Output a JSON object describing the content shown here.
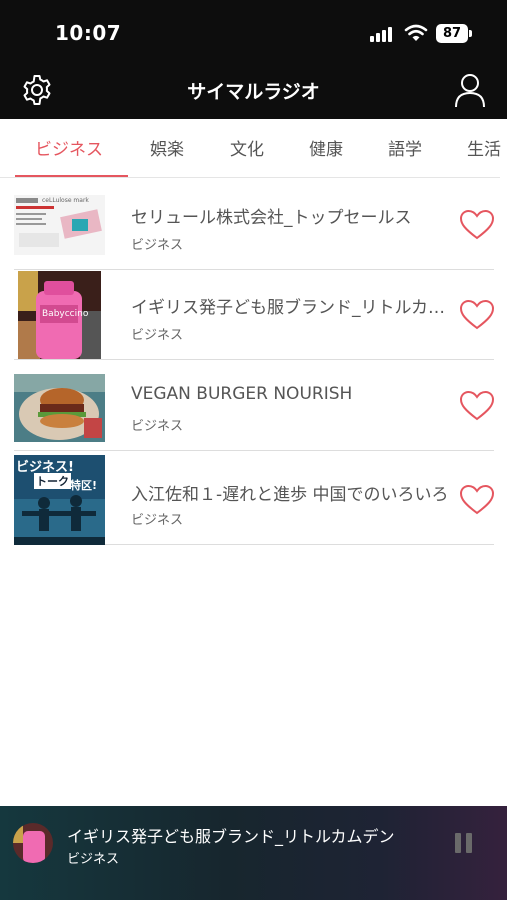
{
  "status_bar": {
    "time": "10:07",
    "battery": "87"
  },
  "header": {
    "title": "サイマルラジオ",
    "settings_icon": "gear-icon",
    "account_icon": "user-icon"
  },
  "tabs": [
    {
      "label": "ビジネス",
      "active": true
    },
    {
      "label": "娯楽",
      "active": false
    },
    {
      "label": "文化",
      "active": false
    },
    {
      "label": "健康",
      "active": false
    },
    {
      "label": "語学",
      "active": false
    },
    {
      "label": "生活",
      "active": false
    }
  ],
  "items": [
    {
      "title": "セリュール株式会社_トップセールス",
      "category": "ビジネス",
      "thumb_text": "ceLLulose mark",
      "favorite": false
    },
    {
      "title": "イギリス発子ども服ブランド_リトルカムデン",
      "category": "ビジネス",
      "thumb_text": "Babyccino",
      "favorite": false
    },
    {
      "title": "VEGAN BURGER NOURISH",
      "category": "ビジネス",
      "favorite": false
    },
    {
      "title": "入江佐和１-遅れと進歩 中国でのいろいろ",
      "category": "ビジネス",
      "thumb_text_1": "ビジネス!",
      "thumb_text_2": "トーク",
      "thumb_text_3": "特区!",
      "favorite": false
    }
  ],
  "player": {
    "title": "イギリス発子ども服ブランド_リトルカムデン",
    "category": "ビジネス",
    "state_icon": "pause-icon"
  },
  "colors": {
    "accent": "#e5565f",
    "header_bg": "#0d0d0d"
  }
}
